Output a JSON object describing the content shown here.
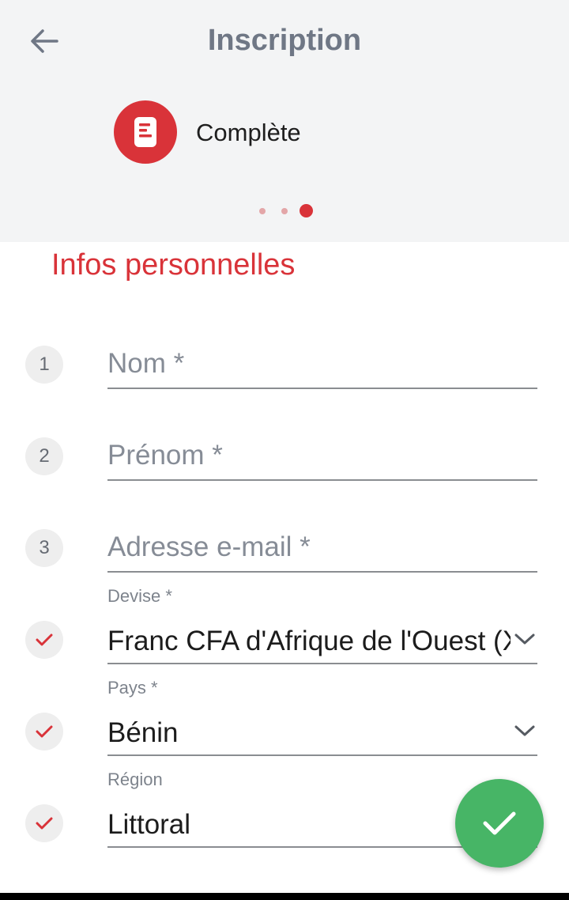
{
  "header": {
    "title": "Inscription",
    "step_label": "Complète",
    "back_icon": "arrow-left-icon",
    "step_icon": "document-icon",
    "page_indicator": {
      "total": 3,
      "active": 3
    }
  },
  "section": {
    "title": "Infos personnelles"
  },
  "form": {
    "fields": [
      {
        "number": "1",
        "placeholder": "Nom *"
      },
      {
        "number": "2",
        "placeholder": "Prénom *"
      },
      {
        "number": "3",
        "placeholder": "Adresse e-mail *"
      },
      {
        "label": "Devise *",
        "value": "Franc CFA d'Afrique de l'Ouest (XOF)",
        "status_icon": "check-icon",
        "dropdown_icon": "chevron-down-icon"
      },
      {
        "label": "Pays *",
        "value": "Bénin",
        "status_icon": "check-icon",
        "dropdown_icon": "chevron-down-icon"
      },
      {
        "label": "Région",
        "value": "Littoral",
        "status_icon": "check-icon"
      }
    ]
  },
  "fab": {
    "icon": "check-icon"
  },
  "colors": {
    "accent": "#d93339",
    "success": "#47b566",
    "header_bg": "#f3f4f5",
    "title_gray": "#6f7785"
  }
}
